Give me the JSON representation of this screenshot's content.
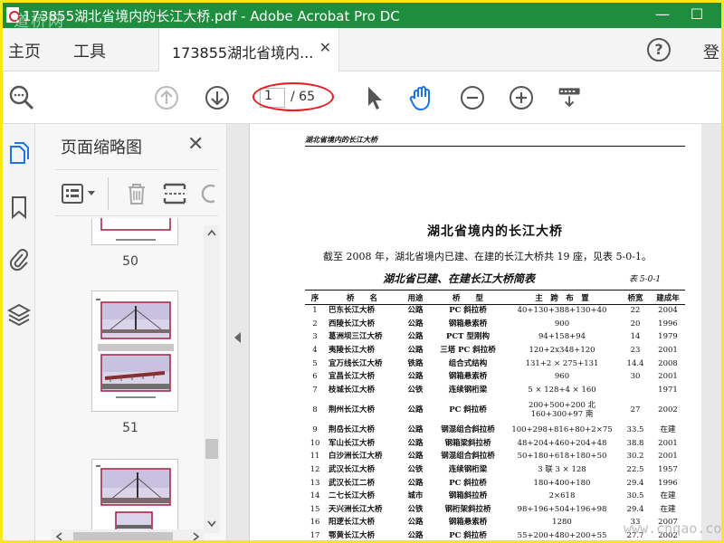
{
  "window": {
    "title": "173855湖北省境内的长江大桥.pdf - Adobe Acrobat Pro DC",
    "minimize_glyph": "—",
    "maximize_glyph": "☐",
    "watermark_top_left": "道桥网"
  },
  "tabs": {
    "home": "主页",
    "tools": "工具",
    "document": "173855湖北省境内...",
    "close_glyph": "✕",
    "help_glyph": "?",
    "signin": "登"
  },
  "toolbar": {
    "current_page": "1",
    "total_pages": "/ 65"
  },
  "thumbnail_panel": {
    "title": "页面缩略图",
    "close_glyph": "✕",
    "pages": [
      {
        "label": "50"
      },
      {
        "label": "51"
      }
    ]
  },
  "document": {
    "running_header": "湖北省境内的长江大桥",
    "title": "湖北省境内的长江大桥",
    "intro": "截至 2008 年，湖北省境内已建、在建的长江大桥共 19 座，见表 5-0-1。",
    "table_caption": "湖北省已建、在建长江大桥简表",
    "table_number": "表 5-0-1",
    "table": {
      "headers": [
        "序",
        "桥　　名",
        "用途",
        "桥　　型",
        "主　跨　布　置",
        "桥宽",
        "建成年"
      ],
      "rows": [
        [
          "1",
          "巴东长江大桥",
          "公路",
          "PC 斜拉桥",
          "40+130+388+130+40",
          "22",
          "2004"
        ],
        [
          "2",
          "西陵长江大桥",
          "公路",
          "钢箱悬索桥",
          "900",
          "20",
          "1996"
        ],
        [
          "3",
          "葛洲坝三江大桥",
          "公路",
          "PCT 型刚构",
          "94+158+94",
          "14",
          "1979"
        ],
        [
          "4",
          "夷陵长江大桥",
          "公路",
          "三塔 PC 斜拉桥",
          "120+2x348+120",
          "23",
          "2001"
        ],
        [
          "5",
          "宜万线长江大桥",
          "铁路",
          "组合式结构",
          "131+2 × 275+131",
          "14.4",
          "2008"
        ],
        [
          "6",
          "宜昌长江大桥",
          "公路",
          "钢箱悬索桥",
          "960",
          "30",
          "2001"
        ],
        [
          "7",
          "枝城长江大桥",
          "公铁",
          "连续钢桁梁",
          "5 × 128+4 × 160",
          "",
          "1971"
        ],
        [
          "8",
          "荆州长江大桥",
          "公路",
          "PC 斜拉桥",
          "200+500+200 北\n160+300+97 南",
          "27",
          "2002"
        ],
        [
          "9",
          "荆岳长江大桥",
          "公路",
          "钢混组合斜拉桥",
          "100+298+816+80+2×75",
          "33.5",
          "在建"
        ],
        [
          "10",
          "军山长江大桥",
          "公路",
          "钢箱梁斜拉桥",
          "48+204+460+204+48",
          "38.8",
          "2001"
        ],
        [
          "11",
          "白沙洲长江大桥",
          "公路",
          "钢混组合斜拉桥",
          "50+180+618+180+50",
          "30.2",
          "2001"
        ],
        [
          "12",
          "武汉长江大桥",
          "公铁",
          "连续钢桁梁",
          "3 联 3 × 128",
          "22.5",
          "1957"
        ],
        [
          "13",
          "武汉长江二桥",
          "公路",
          "PC 斜拉桥",
          "180+400+180",
          "29.4",
          "1996"
        ],
        [
          "14",
          "二七长江大桥",
          "城市",
          "钢箱斜拉桥",
          "2×618",
          "30.5",
          "在建"
        ],
        [
          "15",
          "天兴洲长江大桥",
          "公铁",
          "钢桁架斜拉桥",
          "98+196+504+196+98",
          "29.4",
          "在建"
        ],
        [
          "16",
          "阳逻长江大桥",
          "公路",
          "钢箱悬索桥",
          "1280",
          "33",
          "2007"
        ],
        [
          "17",
          "鄂黄长江大桥",
          "公路",
          "PC 斜拉桥",
          "55+200+480+200+55",
          "27.7",
          "2002"
        ]
      ]
    }
  },
  "watermark_bottom_right": "www.cnqao.com",
  "colors": {
    "titlebar": "#1e8e3e",
    "highlight_ellipse": "#e51c23",
    "thumb_border": "#a01c3c",
    "active_icon_blue": "#1a73e8"
  }
}
